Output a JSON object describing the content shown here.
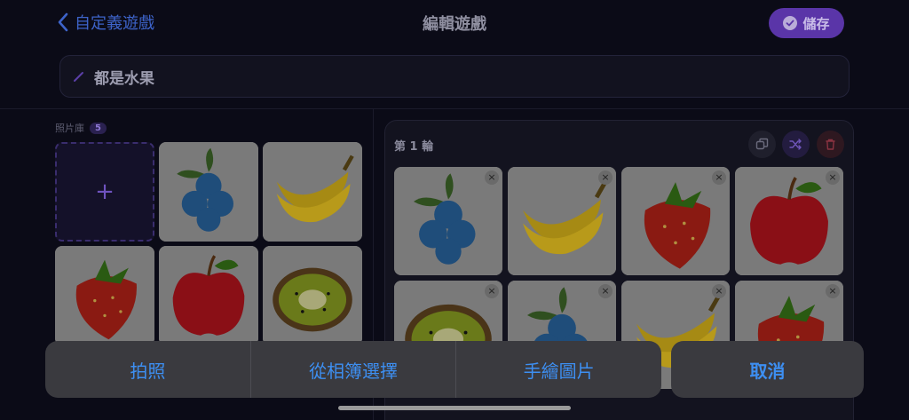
{
  "header": {
    "back_label": "自定義遊戲",
    "title": "編輯遊戲",
    "save_label": "儲存"
  },
  "game_name": {
    "value": "都是水果"
  },
  "library": {
    "label": "照片庫",
    "count": "5",
    "add_symbol": "+",
    "items": [
      "blueberry",
      "banana",
      "strawberry",
      "apple",
      "kiwi"
    ]
  },
  "round": {
    "label": "第 1 輪",
    "buttons": [
      "copy-icon",
      "shuffle-icon",
      "trash-icon"
    ],
    "slots": [
      "blueberry",
      "banana",
      "strawberry",
      "apple",
      "kiwi",
      "blueberry",
      "banana",
      "strawberry"
    ],
    "remove_symbol": "×"
  },
  "action_sheet": {
    "options": [
      "拍照",
      "從相簿選擇",
      "手繪圖片"
    ],
    "cancel_label": "取消"
  },
  "colors": {
    "accent": "#5a35a8",
    "link": "#3d8ff2",
    "back": "#3d63c9"
  }
}
